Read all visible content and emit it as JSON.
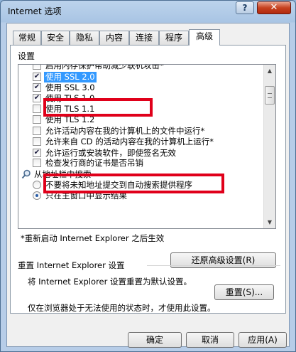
{
  "window": {
    "title": "Internet 选项",
    "help_label": "?",
    "close_label": "✕"
  },
  "tabs": [
    {
      "label": "常规"
    },
    {
      "label": "安全"
    },
    {
      "label": "隐私"
    },
    {
      "label": "内容"
    },
    {
      "label": "连接"
    },
    {
      "label": "程序"
    },
    {
      "label": "高级",
      "active": true
    }
  ],
  "settings": {
    "label": "设置",
    "items": [
      {
        "type": "checkbox",
        "checked": false,
        "text": "启用内存保护帮助减少联机攻击*"
      },
      {
        "type": "checkbox",
        "checked": true,
        "text": "使用 SSL 2.0",
        "selected": true
      },
      {
        "type": "checkbox",
        "checked": true,
        "text": "使用 SSL 3.0"
      },
      {
        "type": "checkbox",
        "checked": true,
        "text": "使用 TLS 1.0"
      },
      {
        "type": "checkbox",
        "checked": false,
        "text": "使用 TLS 1.1"
      },
      {
        "type": "checkbox",
        "checked": false,
        "text": "使用 TLS 1.2"
      },
      {
        "type": "checkbox",
        "checked": false,
        "text": "允许活动内容在我的计算机上的文件中运行*"
      },
      {
        "type": "checkbox",
        "checked": false,
        "text": "允许来自 CD 的活动内容在我的计算机上运行*"
      },
      {
        "type": "checkbox",
        "checked": true,
        "text": "允许运行或安装软件，即使签名无效"
      },
      {
        "type": "checkbox",
        "checked": false,
        "text": "检查发行商的证书是否吊销"
      },
      {
        "type": "section",
        "icon": "search-icon",
        "text": "从地址栏中搜索"
      },
      {
        "type": "radio",
        "checked": false,
        "text": "不要将未知地址提交到自动搜索提供程序"
      },
      {
        "type": "radio",
        "checked": true,
        "text": "只在主窗口中显示结果"
      }
    ]
  },
  "restart_note": "*重新启动 Internet Explorer 之后生效",
  "restore_button": "还原高级设置(R)",
  "reset_group": {
    "title": "重置 Internet Explorer 设置",
    "description": "将 Internet Explorer 设置重置为默认设置。",
    "button": "重置(S)...",
    "note": "仅在浏览器处于无法使用的状态时，才使用此设置。"
  },
  "footer": {
    "ok": "确定",
    "cancel": "取消",
    "apply": "应用(A)"
  },
  "colors": {
    "highlight_box": "#e0001a",
    "selection": "#3399ff"
  }
}
